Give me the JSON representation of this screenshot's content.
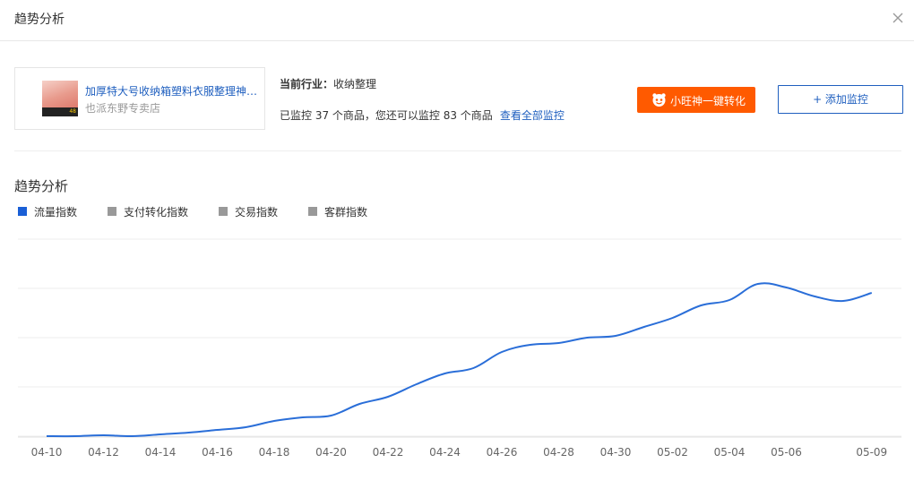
{
  "dialog": {
    "title": "趋势分析",
    "close_icon": "close-icon"
  },
  "product": {
    "name": "加厚特大号收纳箱塑料衣服整理神…",
    "shop": "也派东野专卖店",
    "thumb_badge": "48"
  },
  "industry": {
    "label": "当前行业：",
    "value": "收纳整理"
  },
  "monitor": {
    "text": "已监控 37 个商品，您还可以监控 83 个商品",
    "view_all": "查看全部监控"
  },
  "buttons": {
    "wangwang_label": "小旺神一键转化",
    "wangwang_icon": "wangwang-icon",
    "add_monitor": "+ 添加监控"
  },
  "section": {
    "title": "趋势分析"
  },
  "legend": [
    {
      "label": "流量指数",
      "color": "#1a5fd6",
      "active": true
    },
    {
      "label": "支付转化指数",
      "color": "#999999",
      "active": false
    },
    {
      "label": "交易指数",
      "color": "#999999",
      "active": false
    },
    {
      "label": "客群指数",
      "color": "#999999",
      "active": false
    }
  ],
  "colors": {
    "accent": "#1f5fbf",
    "brand_orange": "#ff5a00",
    "series_line": "#2a6ed8",
    "grid": "#eeeeee"
  },
  "chart_data": {
    "type": "line",
    "title": "",
    "xlabel": "",
    "ylabel": "",
    "grid": true,
    "y_axis_labels_shown": false,
    "ylim": [
      0,
      100
    ],
    "x_ticks": [
      "04-10",
      "04-12",
      "04-14",
      "04-16",
      "04-18",
      "04-20",
      "04-22",
      "04-24",
      "04-26",
      "04-28",
      "04-30",
      "05-02",
      "05-04",
      "05-06",
      "05-09"
    ],
    "x": [
      "04-10",
      "04-11",
      "04-12",
      "04-13",
      "04-14",
      "04-15",
      "04-16",
      "04-17",
      "04-18",
      "04-19",
      "04-20",
      "04-21",
      "04-22",
      "04-23",
      "04-24",
      "04-25",
      "04-26",
      "04-27",
      "04-28",
      "04-29",
      "04-30",
      "05-01",
      "05-02",
      "05-03",
      "05-04",
      "05-05",
      "05-06",
      "05-07",
      "05-08",
      "05-09"
    ],
    "series": [
      {
        "name": "流量指数",
        "values": [
          0,
          0,
          0.5,
          0,
          1,
          2,
          3.5,
          5,
          8.5,
          10.5,
          11.5,
          18,
          22,
          29,
          35,
          38,
          47,
          51,
          52,
          55,
          56,
          61,
          66,
          73,
          76,
          85,
          83,
          78,
          75.5,
          80
        ]
      }
    ]
  }
}
